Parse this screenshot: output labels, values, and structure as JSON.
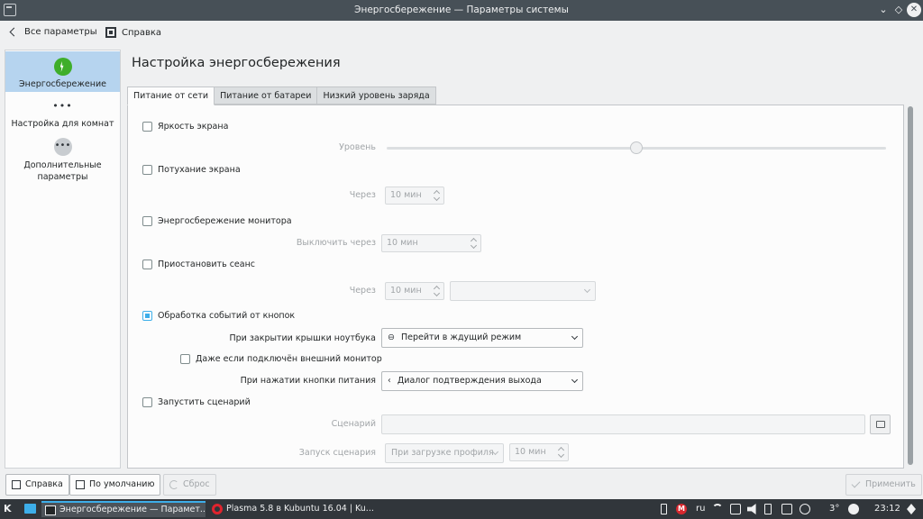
{
  "window": {
    "title": "Энергосбережение — Параметры системы",
    "controls": {
      "minimize": "⌄",
      "maximize": "◇",
      "close": "✕"
    }
  },
  "toolbar": {
    "back_label": "Все параметры",
    "help_label": "Справка"
  },
  "sidebar": {
    "items": [
      {
        "label": "Энергосбережение",
        "icon": "energy-icon",
        "active": true
      },
      {
        "label": "Настройка для комнат",
        "icon": "dots-icon"
      },
      {
        "label": "Дополнительные параметры",
        "icon": "more-icon"
      }
    ]
  },
  "main": {
    "title": "Настройка энергосбережения",
    "tabs": [
      {
        "label": "Питание от сети",
        "active": true
      },
      {
        "label": "Питание от батареи"
      },
      {
        "label": "Низкий уровень заряда"
      }
    ],
    "settings": {
      "brightness": {
        "label": "Яркость экрана",
        "checked": false,
        "level_label": "Уровень",
        "level_value": 0.5
      },
      "dim": {
        "label": "Потухание экрана",
        "checked": false,
        "after_label": "Через",
        "after_value": "10 мин"
      },
      "dpms": {
        "label": "Энергосбережение монитора",
        "checked": false,
        "off_label": "Выключить через",
        "off_value": "10 мин"
      },
      "suspend": {
        "label": "Приостановить сеанс",
        "checked": false,
        "after_label": "Через",
        "after_value": "10 мин",
        "action_value": ""
      },
      "buttons": {
        "label": "Обработка событий от кнопок",
        "checked": true,
        "lid_label": "При закрытии крышки ноутбука",
        "lid_value": "Перейти в ждущий режим",
        "external_label": "Даже если подключён внешний монитор",
        "power_label": "При нажатии кнопки питания",
        "power_value": "Диалог подтверждения выхода"
      },
      "script": {
        "label": "Запустить сценарий",
        "checked": false,
        "script_label": "Сценарий",
        "script_value": "",
        "run_label": "Запуск сценария",
        "run_value": "При загрузке профиля",
        "run_delay": "10 мин"
      }
    }
  },
  "footer": {
    "help_label": "Справка",
    "defaults_label": "По умолчанию",
    "reset_label": "Сброс",
    "apply_label": "Применить"
  },
  "taskbar": {
    "tasks": [
      {
        "label": "Энергосбережение — Парамет...",
        "active": true
      },
      {
        "label": "Plasma 5.8 в Kubuntu 16.04 | Ku..."
      }
    ],
    "tray": {
      "mega_badge": "M",
      "lang": "ru",
      "temperature": "3°",
      "clock": "23:12"
    }
  }
}
